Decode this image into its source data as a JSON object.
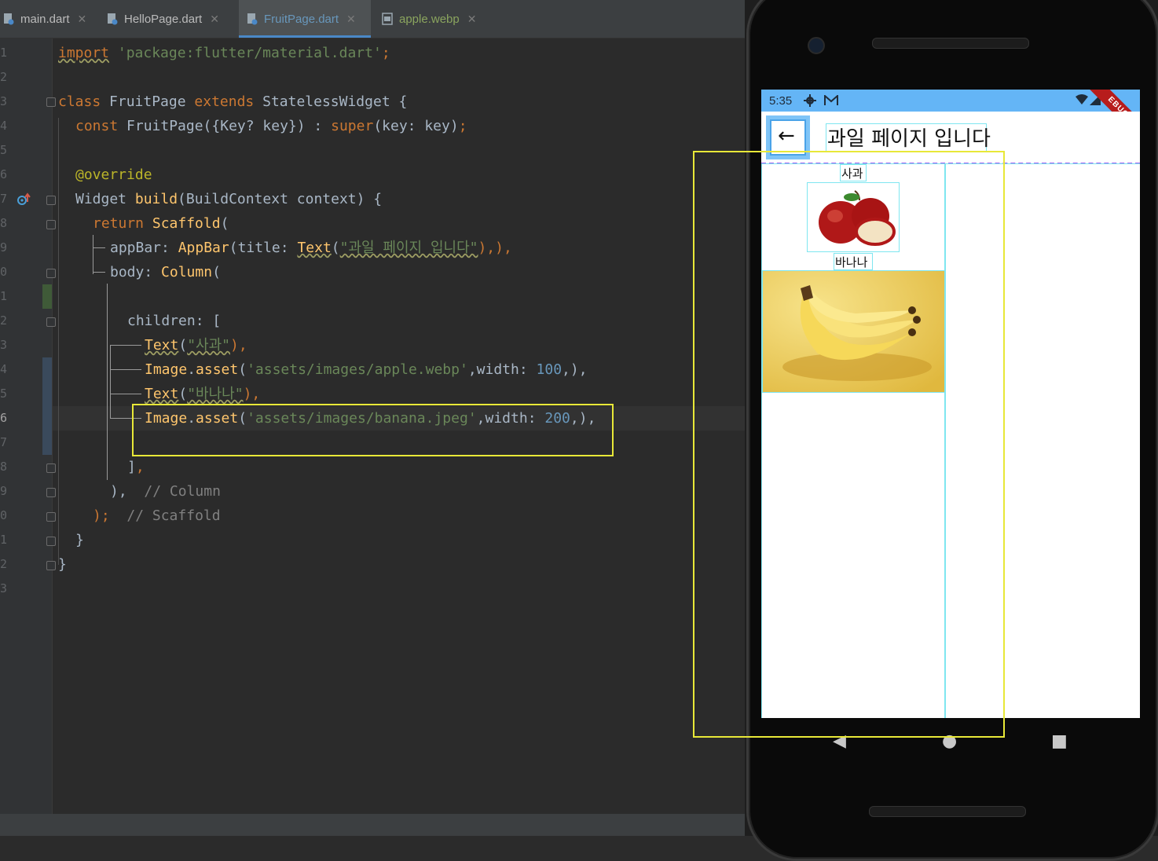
{
  "tabs": [
    {
      "label": "main.dart",
      "active": false
    },
    {
      "label": "HelloPage.dart",
      "active": false
    },
    {
      "label": "FruitPage.dart",
      "active": true
    },
    {
      "label": "apple.webp",
      "active": false
    }
  ],
  "close_glyph": "✕",
  "line_numbers": [
    "1",
    "2",
    "3",
    "4",
    "5",
    "6",
    "7",
    "8",
    "9",
    "0",
    "1",
    "2",
    "3",
    "4",
    "5",
    "6",
    "7",
    "8",
    "9",
    "0",
    "1",
    "2",
    "3"
  ],
  "code": {
    "l1_kw": "import",
    "l1_str": "'package:flutter/material.dart'",
    "l1_semi": ";",
    "l3_kw1": "class",
    "l3_name": " FruitPage ",
    "l3_kw2": "extends",
    "l3_rest": " StatelessWidget {",
    "l4_kw": "const",
    "l4_mid": " FruitPage({Key? key}) : ",
    "l4_super": "super",
    "l4_rest": "(key: key)",
    "l4_semi": ";",
    "l6_ann": "@override",
    "l7_type": "Widget ",
    "l7_fn": "build",
    "l7_rest": "(BuildContext context) {",
    "l8_kw": "return",
    "l8_cls": " Scaffold",
    "l8_rest": "(",
    "l9_a": "appBar: ",
    "l9_cls": "AppBar",
    "l9_b": "(title: ",
    "l9_text": "Text",
    "l9_c": "(",
    "l9_str": "\"과일 페이지 입니다\"",
    "l9_d": "),",
    "l9_e": "),",
    "l10_a": "body: ",
    "l10_cls": "Column",
    "l10_b": "(",
    "l12": "children: [",
    "l13_text": "Text",
    "l13_a": "(",
    "l13_str": "\"사과\"",
    "l13_b": "),",
    "l14_cls": "Image",
    "l14_a": ".",
    "l14_fn": "asset",
    "l14_b": "(",
    "l14_str": "'assets/images/apple.webp'",
    "l14_c": ",width: ",
    "l14_num": "100",
    "l14_d": ",),",
    "l15_text": "Text",
    "l15_a": "(",
    "l15_str": "\"바나나\"",
    "l15_b": "),",
    "l16_cls": "Image",
    "l16_a": ".",
    "l16_fn": "asset",
    "l16_b": "(",
    "l16_str": "'assets/images/banana.jpeg'",
    "l16_c": ",width: ",
    "l16_num": "200",
    "l16_d": ",),",
    "l18_a": "]",
    "l18_b": ",",
    "l19_a": "),",
    "l19_cmt": "// Column",
    "l20_a": ");",
    "l20_cmt": "// Scaffold",
    "l21": "}",
    "l22": "}"
  },
  "phone": {
    "time": "5:35",
    "appbar_title": "과일 페이지 입니다",
    "back_glyph": "←",
    "debug_banner": "EBUG",
    "apple_label": "사과",
    "banana_label": "바나나",
    "nav_back": "◀",
    "nav_home": "●",
    "nav_recents": "■"
  },
  "colors": {
    "status_bar": "#64b5f6",
    "highlight_yellow": "#e8e838",
    "debug_inspector_cyan": "#7fe6f0"
  }
}
